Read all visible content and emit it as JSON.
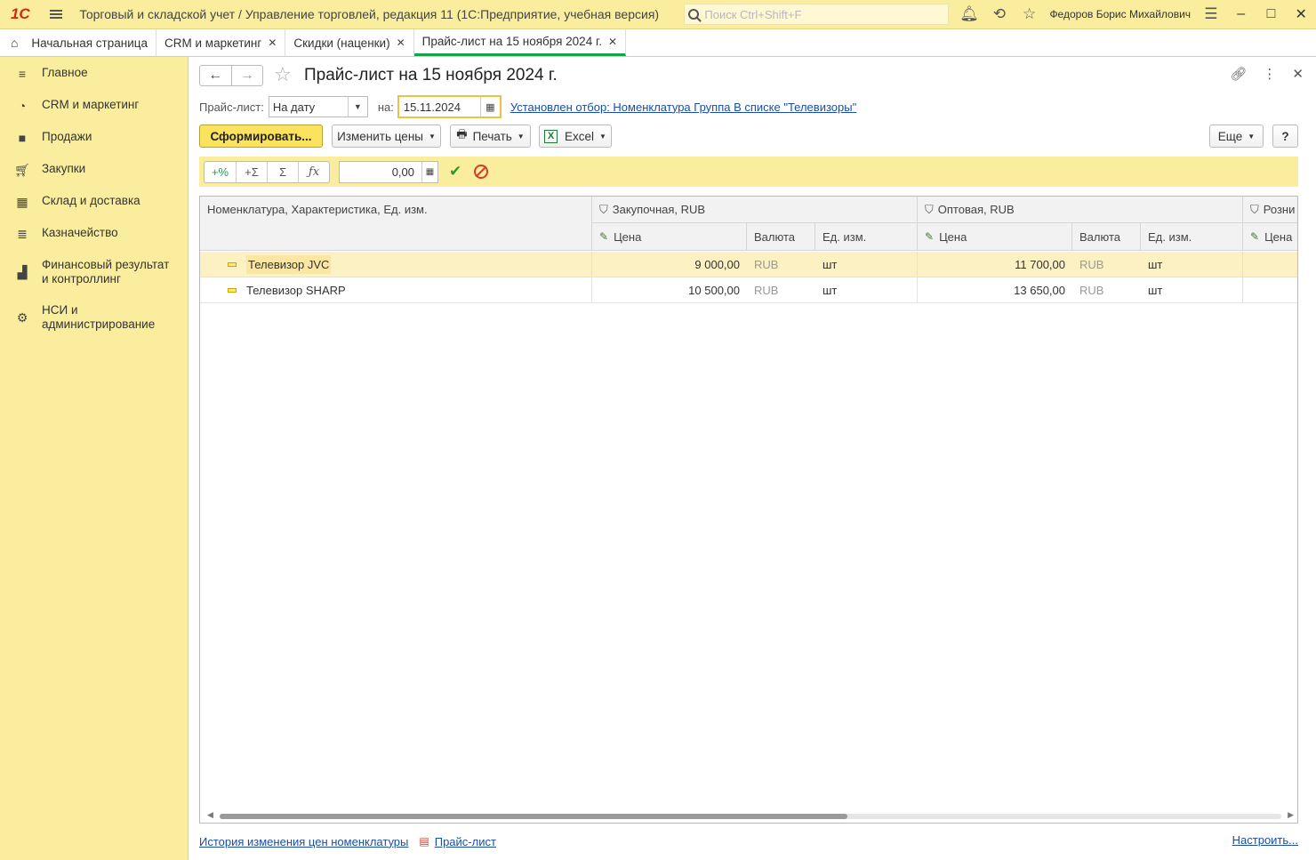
{
  "titlebar": {
    "logo": "1С",
    "title": "Торговый и складской учет / Управление торговлей, редакция 11  (1С:Предприятие, учебная версия)",
    "search_placeholder": "Поиск Ctrl+Shift+F",
    "user": "Федоров Борис Михайлович"
  },
  "tabs": [
    {
      "label": "Начальная страница"
    },
    {
      "label": "CRM и маркетинг"
    },
    {
      "label": "Скидки (наценки)"
    },
    {
      "label": "Прайс-лист на 15 ноября 2024 г."
    }
  ],
  "sidebar": {
    "items": [
      {
        "label": "Главное",
        "icon": "menu-icon"
      },
      {
        "label": "CRM и маркетинг",
        "icon": "pie-chart-icon"
      },
      {
        "label": "Продажи",
        "icon": "shopping-bag-icon"
      },
      {
        "label": "Закупки",
        "icon": "cart-icon"
      },
      {
        "label": "Склад и доставка",
        "icon": "warehouse-icon"
      },
      {
        "label": "Казначейство",
        "icon": "coins-icon"
      },
      {
        "label": "Финансовый результат и контроллинг",
        "icon": "bar-chart-icon"
      },
      {
        "label": "НСИ и администрирование",
        "icon": "gear-icon"
      }
    ]
  },
  "form": {
    "title": "Прайс-лист на 15 ноября 2024 г.",
    "price_list_label": "Прайс-лист:",
    "price_list_value": "На дату",
    "date_label": "на:",
    "date_value": "15.11.2024",
    "filter_link": "Установлен отбор: Номенклатура Группа В списке \"Телевизоры\"",
    "buttons": {
      "generate": "Сформировать...",
      "change_prices": "Изменить цены",
      "print": "Печать",
      "excel": "Excel",
      "more": "Еще",
      "help": "?"
    },
    "calc": {
      "plus_percent": "+%",
      "plus_sigma": "+Σ",
      "sigma": "Σ",
      "fx": "ƒx",
      "value": "0,00"
    }
  },
  "grid": {
    "col_name": "Номенклатура, Характеристика, Ед. изм.",
    "groups": [
      "Закупочная, RUB",
      "Оптовая, RUB",
      "Розни"
    ],
    "sub": {
      "price": "Цена",
      "currency": "Валюта",
      "unit": "Ед. изм."
    },
    "rows": [
      {
        "name": "Телевизор JVC",
        "p1": "9 000,00",
        "c1": "RUB",
        "u1": "шт",
        "p2": "11 700,00",
        "c2": "RUB",
        "u2": "шт"
      },
      {
        "name": "Телевизор SHARP",
        "p1": "10 500,00",
        "c1": "RUB",
        "u1": "шт",
        "p2": "13 650,00",
        "c2": "RUB",
        "u2": "шт"
      }
    ]
  },
  "footer": {
    "history_link": "История изменения цен номенклатуры",
    "report_link": "Прайс-лист",
    "settings_link": "Настроить..."
  }
}
